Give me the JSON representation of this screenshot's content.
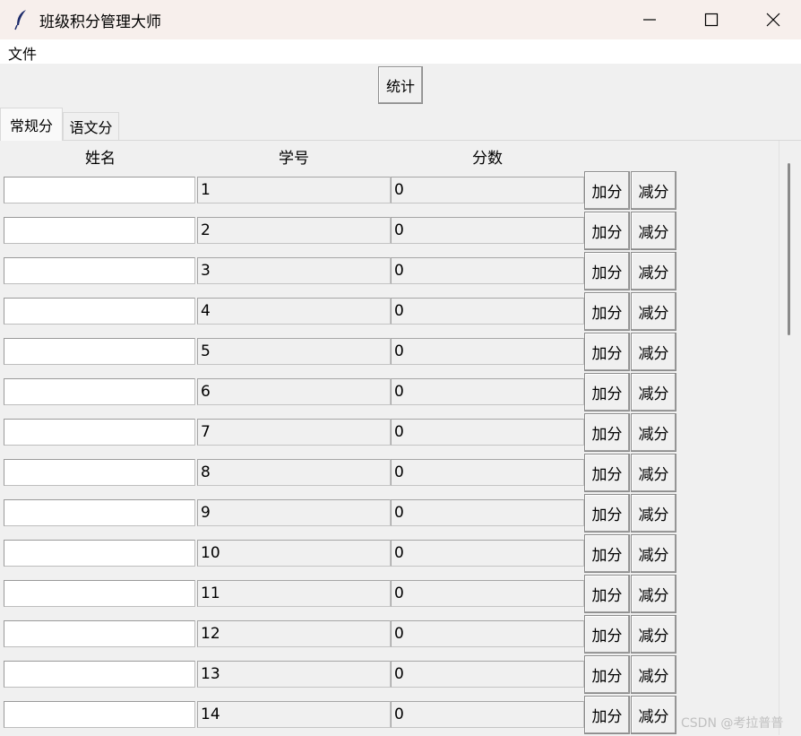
{
  "window": {
    "title": "班级积分管理大师",
    "icon": "feather-icon"
  },
  "menu": {
    "file_label": "文件"
  },
  "toolbar": {
    "stats_label": "统计"
  },
  "tabs": [
    {
      "label": "常规分",
      "active": true
    },
    {
      "label": "语文分",
      "active": false
    }
  ],
  "columns": {
    "name": "姓名",
    "id": "学号",
    "score": "分数"
  },
  "buttons": {
    "add": "加分",
    "sub": "减分"
  },
  "rows": [
    {
      "name": "",
      "id": "1",
      "score": "0"
    },
    {
      "name": "",
      "id": "2",
      "score": "0"
    },
    {
      "name": "",
      "id": "3",
      "score": "0"
    },
    {
      "name": "",
      "id": "4",
      "score": "0"
    },
    {
      "name": "",
      "id": "5",
      "score": "0"
    },
    {
      "name": "",
      "id": "6",
      "score": "0"
    },
    {
      "name": "",
      "id": "7",
      "score": "0"
    },
    {
      "name": "",
      "id": "8",
      "score": "0"
    },
    {
      "name": "",
      "id": "9",
      "score": "0"
    },
    {
      "name": "",
      "id": "10",
      "score": "0"
    },
    {
      "name": "",
      "id": "11",
      "score": "0"
    },
    {
      "name": "",
      "id": "12",
      "score": "0"
    },
    {
      "name": "",
      "id": "13",
      "score": "0"
    },
    {
      "name": "",
      "id": "14",
      "score": "0"
    }
  ],
  "watermark": "CSDN @考拉普普"
}
